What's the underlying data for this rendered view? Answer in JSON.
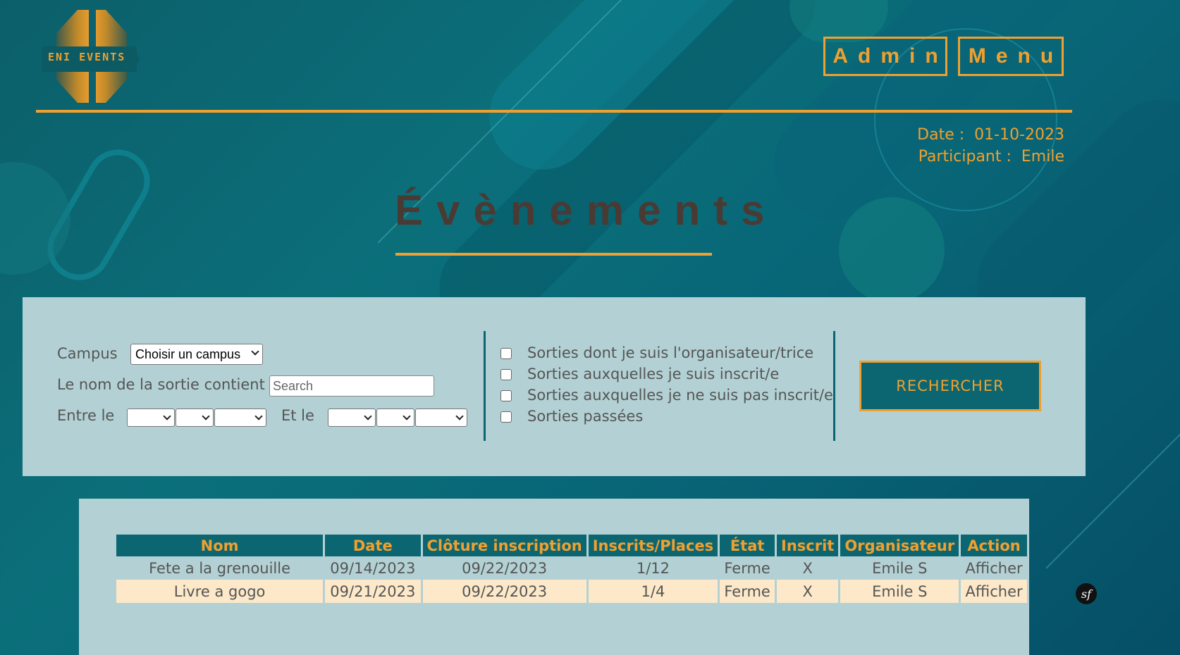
{
  "logo": {
    "text": "ENI EVENTS"
  },
  "nav": {
    "admin": "Admin",
    "menu": "Menu"
  },
  "info": {
    "date_label": "Date :",
    "date_value": "01-10-2023",
    "participant_label": "Participant :",
    "participant_value": "Emile"
  },
  "page_title": "Évènements",
  "filters": {
    "campus_label": "Campus",
    "campus_selected": "Choisir un campus",
    "name_label": "Le nom de la sortie contient",
    "name_placeholder": "Search",
    "between_label": "Entre le",
    "and_label": "Et le",
    "checkboxes": [
      "Sorties dont je suis l'organisateur/trice",
      "Sorties auxquelles je suis inscrit/e",
      "Sorties auxquelles je ne suis pas inscrit/e",
      "Sorties passées"
    ],
    "search_button": "RECHERCHER"
  },
  "table": {
    "headers": [
      "Nom",
      "Date",
      "Clôture inscription",
      "Inscrits/Places",
      "État",
      "Inscrit",
      "Organisateur",
      "Action"
    ],
    "rows": [
      [
        "Fete a la grenouille",
        "09/14/2023",
        "09/22/2023",
        "1/12",
        "Ferme",
        "X",
        "Emile S",
        "Afficher"
      ],
      [
        "Livre a gogo",
        "09/21/2023",
        "09/22/2023",
        "1/4",
        "Ferme",
        "X",
        "Emile S",
        "Afficher"
      ]
    ]
  },
  "colors": {
    "accent": "#f0a030",
    "teal": "#0b6672",
    "panel": "#b3d1d4",
    "row_alt": "#fde9c9"
  },
  "icons": {
    "symfony": "symfony-icon"
  }
}
